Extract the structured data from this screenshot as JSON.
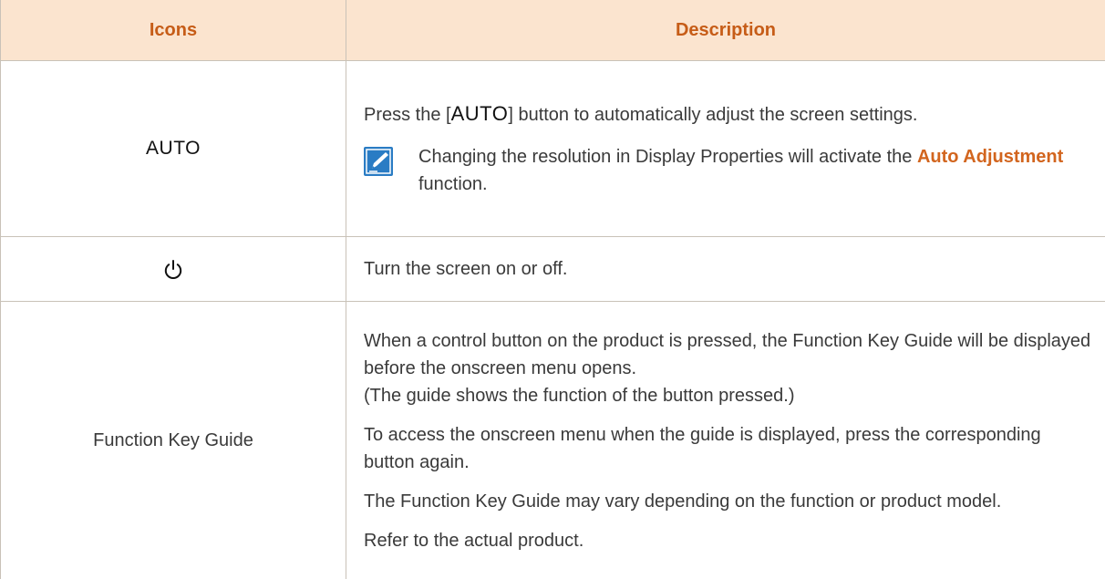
{
  "header": {
    "col_icons": "Icons",
    "col_description": "Description"
  },
  "rows": {
    "auto": {
      "icon_label": "AUTO",
      "desc_before": "Press the [",
      "desc_key": "AUTO",
      "desc_after": "] button to automatically adjust the screen settings.",
      "note_before": "Changing the resolution in Display Properties will activate the ",
      "note_highlight": "Auto Adjustment",
      "note_after": " function."
    },
    "power": {
      "icon": "power-icon",
      "desc": "Turn the screen on or off."
    },
    "fkg": {
      "icon_label": "Function Key Guide",
      "p1_line1": "When a control button on the product is pressed, the Function Key Guide will be displayed before the onscreen menu opens.",
      "p1_line2": "(The guide shows the function of the button pressed.)",
      "p2": "To access the onscreen menu when the guide is displayed, press the corresponding button again.",
      "p3": "The Function Key Guide may vary depending on the function or product model.",
      "p4": "Refer to the actual product."
    }
  },
  "colors": {
    "header_bg": "#fbe4cf",
    "header_text": "#c65c17",
    "highlight": "#d2651e",
    "note_icon_bg": "#2a7cc4",
    "border": "#c9c2b8"
  }
}
